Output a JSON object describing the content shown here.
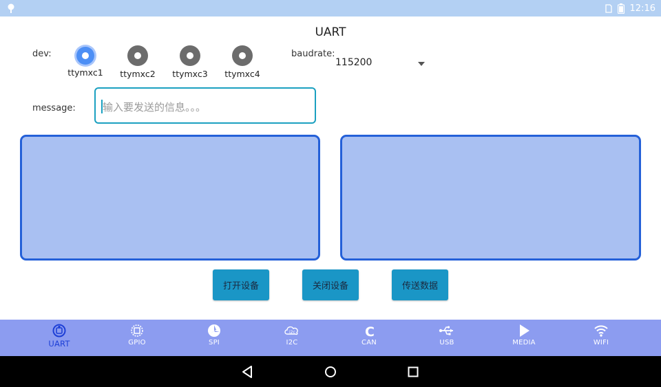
{
  "status_bar": {
    "time": "12:16",
    "left_icon": "location-pin-icon",
    "right_icons": [
      "sim-icon",
      "battery-icon"
    ],
    "background": "#b3d0f3"
  },
  "page": {
    "title": "UART"
  },
  "dev": {
    "label": "dev:",
    "options": [
      {
        "label": "ttymxc1",
        "checked": true
      },
      {
        "label": "ttymxc2",
        "checked": false
      },
      {
        "label": "ttymxc3",
        "checked": false
      },
      {
        "label": "ttymxc4",
        "checked": false
      }
    ]
  },
  "baudrate": {
    "label": "baudrate:",
    "value": "115200"
  },
  "message": {
    "label": "message:",
    "placeholder": "输入要发送的信息。。。"
  },
  "buttons": {
    "open": "打开设备",
    "close": "关闭设备",
    "send": "传送数据"
  },
  "bottom_nav": {
    "items": [
      {
        "label": "UART",
        "icon": "uart-icon",
        "active": true
      },
      {
        "label": "GPIO",
        "icon": "gpio-chip-icon",
        "active": false
      },
      {
        "label": "SPI",
        "icon": "spi-icon",
        "active": false
      },
      {
        "label": "I2C",
        "icon": "i2c-icon",
        "active": false
      },
      {
        "label": "CAN",
        "icon": "can-icon",
        "active": false
      },
      {
        "label": "USB",
        "icon": "usb-icon",
        "active": false
      },
      {
        "label": "MEDIA",
        "icon": "play-icon",
        "active": false
      },
      {
        "label": "WIFI",
        "icon": "wifi-icon",
        "active": false
      }
    ]
  },
  "colors": {
    "accent": "#1a96c6",
    "panel_fill": "#a9c0f2",
    "panel_border": "#2460d8",
    "nav_background": "#8c9cf0",
    "nav_active": "#1d3fd6"
  }
}
